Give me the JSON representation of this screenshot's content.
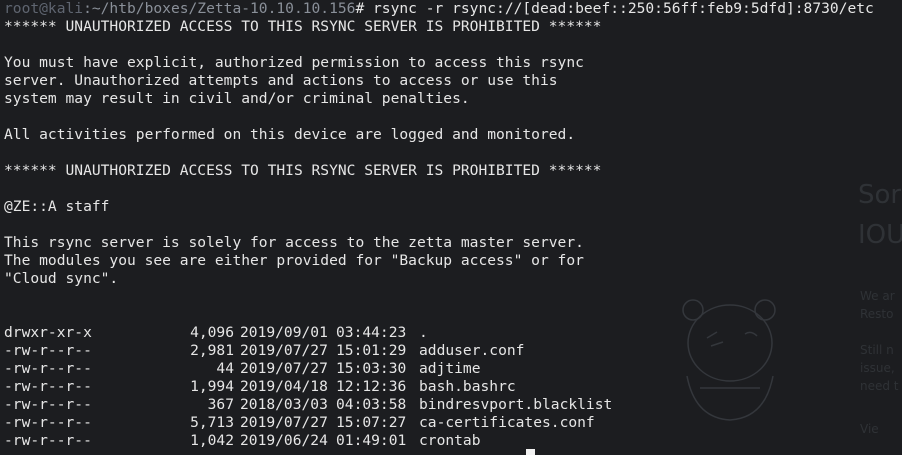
{
  "prompt": {
    "user_host": "root@kali",
    "path": ":~/htb/boxes/Zetta-10.10.10.156",
    "command": "# rsync -r rsync://[dead:beef::250:56ff:feb9:5dfd]:8730/etc"
  },
  "banner": {
    "warning_top": "****** UNAUTHORIZED ACCESS TO THIS RSYNC SERVER IS PROHIBITED ******",
    "p1_l1": "You must have explicit, authorized permission to access this rsync",
    "p1_l2": "server. Unauthorized attempts and actions to access or use this",
    "p1_l3": "system may result in civil and/or criminal penalties.",
    "p2": "All activities performed on this device are logged and monitored.",
    "warning_bottom": "****** UNAUTHORIZED ACCESS TO THIS RSYNC SERVER IS PROHIBITED ******",
    "staff": "@ZE::A staff",
    "p3_l1": "This rsync server is solely for access to the zetta master server.",
    "p3_l2": "The modules you see are either provided for \"Backup access\" or for",
    "p3_l3": "\"Cloud sync\"."
  },
  "listing": [
    {
      "perm": "drwxr-xr-x",
      "size": "4,096",
      "date": "2019/09/01",
      "time": "03:44:23",
      "name": "."
    },
    {
      "perm": "-rw-r--r--",
      "size": "2,981",
      "date": "2019/07/27",
      "time": "15:01:29",
      "name": "adduser.conf"
    },
    {
      "perm": "-rw-r--r--",
      "size": "44",
      "date": "2019/07/27",
      "time": "15:03:30",
      "name": "adjtime"
    },
    {
      "perm": "-rw-r--r--",
      "size": "1,994",
      "date": "2019/04/18",
      "time": "12:12:36",
      "name": "bash.bashrc"
    },
    {
      "perm": "-rw-r--r--",
      "size": "367",
      "date": "2018/03/03",
      "time": "04:03:58",
      "name": "bindresvport.blacklist"
    },
    {
      "perm": "-rw-r--r--",
      "size": "5,713",
      "date": "2019/07/27",
      "time": "15:07:27",
      "name": "ca-certificates.conf"
    },
    {
      "perm": "-rw-r--r--",
      "size": "1,042",
      "date": "2019/06/24",
      "time": "01:49:01",
      "name": "crontab"
    }
  ],
  "background": {
    "t1": "Sor",
    "t2": "IOU",
    "t3": "We ar",
    "t4": "Resto",
    "t5": "Still n",
    "t6": "issue,",
    "t7": "need t",
    "t8": "Vie"
  },
  "colors": {
    "terminal_bg": "#1c1d20",
    "text": "#e6e6e6",
    "prompt_user": "#5f6570",
    "prompt_path": "#8a9099",
    "cursor": "#f2f2f2"
  }
}
